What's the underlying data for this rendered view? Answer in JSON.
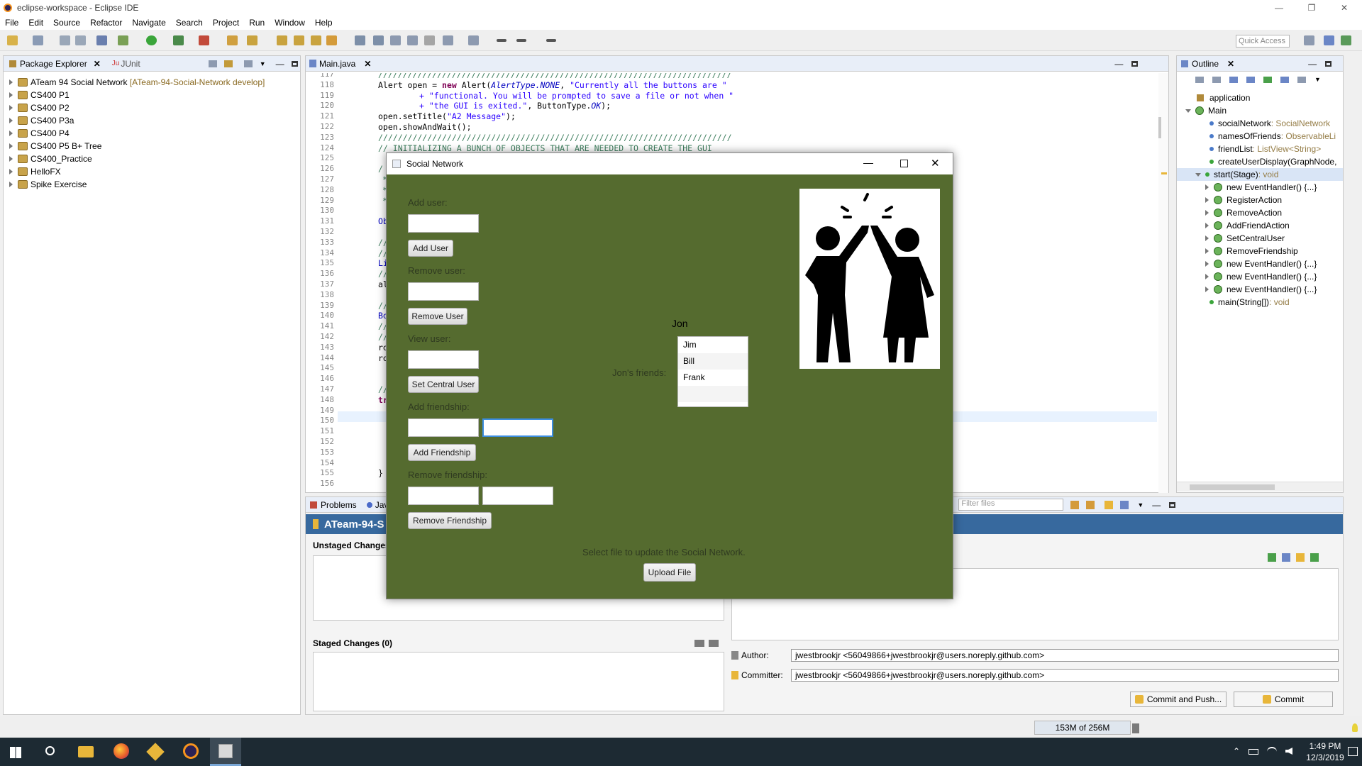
{
  "window": {
    "title": "eclipse-workspace - Eclipse IDE"
  },
  "menu": [
    "File",
    "Edit",
    "Source",
    "Refactor",
    "Navigate",
    "Search",
    "Project",
    "Run",
    "Window",
    "Help"
  ],
  "quick_access": "Quick Access",
  "package_explorer": {
    "tab": "Package Explorer",
    "tab2": "JUnit",
    "projects": [
      {
        "name": "ATeam 94 Social Network",
        "suffix": "[ATeam-94-Social-Network develop]"
      },
      {
        "name": "CS400 P1",
        "suffix": ""
      },
      {
        "name": "CS400 P2",
        "suffix": ""
      },
      {
        "name": "CS400 P3a",
        "suffix": ""
      },
      {
        "name": "CS400 P4",
        "suffix": ""
      },
      {
        "name": "CS400 P5 B+ Tree",
        "suffix": ""
      },
      {
        "name": "CS400_Practice",
        "suffix": ""
      },
      {
        "name": "HelloFX",
        "suffix": ""
      },
      {
        "name": "Spike Exercise",
        "suffix": ""
      }
    ]
  },
  "editor": {
    "tab": "Main.java",
    "line_numbers": [
      "117",
      "118",
      "119",
      "120",
      "121",
      "122",
      "123",
      "124",
      "125",
      "126",
      "127",
      "128",
      "129",
      "130",
      "131",
      "132",
      "133",
      "134",
      "135",
      "136",
      "137",
      "138",
      "139",
      "140",
      "141",
      "142",
      "143",
      "144",
      "145",
      "146",
      "147",
      "148",
      "149",
      "150",
      "151",
      "152",
      "153",
      "154",
      "155",
      "156"
    ],
    "code": {
      "l117": "////////////////////////////////////////////////////////////////////////",
      "l118a": "Alert",
      "l118b": " open = ",
      "l118c": "new",
      "l118d": " Alert(",
      "l118e": "AlertType.NONE",
      "l118f": ", ",
      "l118g": "\"Currently all the buttons are \"",
      "l119": "+ \"functional. You will be prompted to save a file or not when \"",
      "l120a": "+ \"the GUI is exited.\"",
      "l120b": ", ButtonType.",
      "l120c": "OK",
      "l120d": ");",
      "l121a": "open.setTitle(",
      "l121b": "\"A2 Message\"",
      "l121c": ");",
      "l122": "open.showAndWait();",
      "l123": "////////////////////////////////////////////////////////////////////////",
      "l124": "// INITIALIZING A BUNCH OF OBJECTS THAT ARE NEEDED TO CREATE THE GUI",
      "l126": "/",
      "l127": "*",
      "l128": "*",
      "l129": "*",
      "l131": "Ob",
      "l133": "//",
      "l134": "//",
      "l135": "Li",
      "l136": "//",
      "l137": "al",
      "l139": "//",
      "l140": "Bo",
      "l141": "//",
      "l142": "//",
      "l143": "ro",
      "l144": "ro",
      "l147": "//",
      "l148": "tr",
      "l155": "}"
    }
  },
  "outline": {
    "tab": "Outline",
    "items": [
      {
        "label": "application",
        "type": ""
      },
      {
        "label": "Main",
        "type": ""
      },
      {
        "label": "socialNetwork",
        "type": " : SocialNetwork"
      },
      {
        "label": "namesOfFriends",
        "type": " : ObservableLi"
      },
      {
        "label": "friendList",
        "type": " : ListView<String>"
      },
      {
        "label": "createUserDisplay(GraphNode,",
        "type": ""
      },
      {
        "label": "start(Stage)",
        "type": " : void"
      },
      {
        "label": "new EventHandler() {...}",
        "type": ""
      },
      {
        "label": "RegisterAction",
        "type": ""
      },
      {
        "label": "RemoveAction",
        "type": ""
      },
      {
        "label": "AddFriendAction",
        "type": ""
      },
      {
        "label": "SetCentralUser",
        "type": ""
      },
      {
        "label": "RemoveFriendship",
        "type": ""
      },
      {
        "label": "new EventHandler() {...}",
        "type": ""
      },
      {
        "label": "new EventHandler() {...}",
        "type": ""
      },
      {
        "label": "new EventHandler() {...}",
        "type": ""
      },
      {
        "label": "main(String[])",
        "type": " : void"
      }
    ]
  },
  "bottom": {
    "problems_tab": "Problems",
    "java_tab": "Jav",
    "repo_title": "ATeam-94-S",
    "filter_placeholder": "Filter files",
    "unstaged": "Unstaged Changes",
    "staged": "Staged Changes (0)",
    "author_label": "Author:",
    "author": "jwestbrookjr <56049866+jwestbrookjr@users.noreply.github.com>",
    "committer_label": "Committer:",
    "committer": "jwestbrookjr <56049866+jwestbrookjr@users.noreply.github.com>",
    "commit_push": "Commit and Push...",
    "commit": "Commit"
  },
  "status": {
    "memory": "153M of 256M"
  },
  "social": {
    "title": "Social Network",
    "bg": "#556b2f",
    "add_user_label": "Add user:",
    "add_user_btn": "Add User",
    "remove_user_label": "Remove user:",
    "remove_user_btn": "Remove User",
    "view_user_label": "View user:",
    "set_central_btn": "Set Central User",
    "add_friendship_label": "Add friendship:",
    "add_friendship_btn": "Add Friendship",
    "remove_friendship_label": "Remove friendship:",
    "remove_friendship_btn": "Remove Friendship",
    "central_user": "Jon",
    "friends_label": "Jon's friends:",
    "friends": [
      "Jim",
      "Bill",
      "Frank"
    ],
    "upload_prompt": "Select file to update the Social Network.",
    "upload_btn": "Upload File"
  },
  "taskbar": {
    "time": "1:49 PM",
    "date": "12/3/2019"
  }
}
